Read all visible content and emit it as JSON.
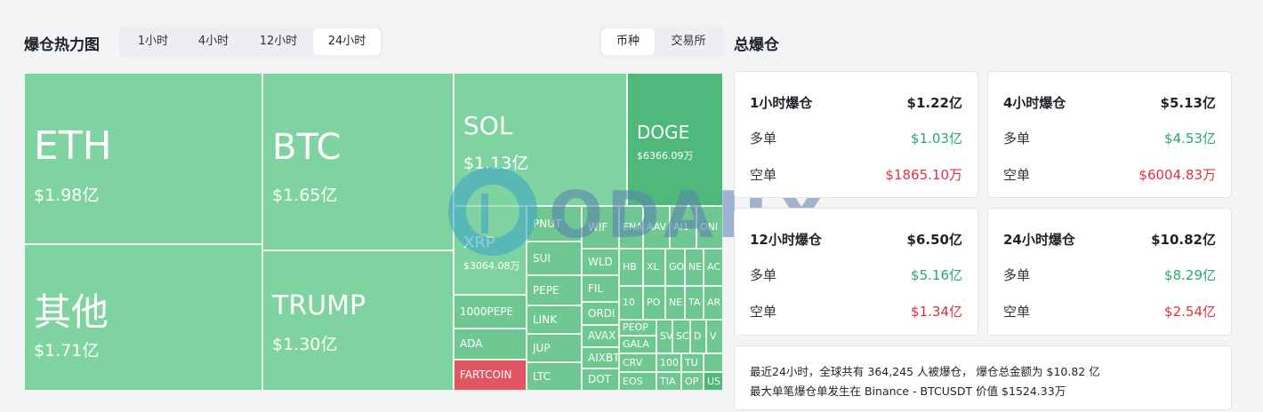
{
  "heatmap": {
    "title": "爆仓热力图",
    "time_tabs": [
      "1小时",
      "4小时",
      "12小时",
      "24小时"
    ],
    "active_time_tab": 3,
    "group_tabs": [
      "币种",
      "交易所"
    ],
    "active_group_tab": 0,
    "tiles": {
      "eth": {
        "symbol": "ETH",
        "value": "$1.98亿"
      },
      "btc": {
        "symbol": "BTC",
        "value": "$1.65亿"
      },
      "other": {
        "symbol": "其他",
        "value": "$1.71亿"
      },
      "trump": {
        "symbol": "TRUMP",
        "value": "$1.30亿"
      },
      "sol": {
        "symbol": "SOL",
        "value": "$1.13亿"
      },
      "doge": {
        "symbol": "DOGE",
        "value": "$6366.09万"
      },
      "xrp": {
        "symbol": "XRP",
        "value": "$3064.08万"
      },
      "small": [
        "PNUT",
        "SUI",
        "PEPE",
        "LINK",
        "JUP",
        "LTC",
        "1000PEPE",
        "ADA",
        "FARTCOIN",
        "WIF",
        "ENA",
        "AAV",
        "AI1",
        "ONI",
        "WLD",
        "FIL",
        "ORDI",
        "AVAX",
        "GALA",
        "AIXBT",
        "CRV",
        "EOS",
        "DOT",
        "HB",
        "XL",
        "GO",
        "NE",
        "AC",
        "10",
        "PO",
        "NE",
        "TA",
        "AR",
        "PEOP",
        "SV",
        "SC",
        "D",
        "V",
        "100",
        "TU",
        "TIA",
        "OP",
        "US"
      ]
    },
    "tile_colors": {
      "base": "#7fd3a0",
      "mid": "#6fc791",
      "deep": "#4fb87b",
      "negative": "#e25563"
    }
  },
  "summary": {
    "title": "总爆仓",
    "cards": [
      {
        "label": "1小时爆仓",
        "total": "$1.22亿",
        "long_label": "多单",
        "long": "$1.03亿",
        "short_label": "空单",
        "short": "$1865.10万"
      },
      {
        "label": "4小时爆仓",
        "total": "$5.13亿",
        "long_label": "多单",
        "long": "$4.53亿",
        "short_label": "空单",
        "short": "$6004.83万"
      },
      {
        "label": "12小时爆仓",
        "total": "$6.50亿",
        "long_label": "多单",
        "long": "$5.16亿",
        "short_label": "空单",
        "short": "$1.34亿"
      },
      {
        "label": "24小时爆仓",
        "total": "$10.82亿",
        "long_label": "多单",
        "long": "$8.29亿",
        "short_label": "空单",
        "short": "$2.54亿"
      }
    ],
    "note_line1": "最近24小时，全球共有 364,245 人被爆仓，  爆仓总金额为 $10.82 亿",
    "note_line2": "最大单笔爆仓单发生在 Binance - BTCUSDT 价值 $1524.33万",
    "long_color": "#27a96a",
    "short_color": "#e0303f"
  },
  "watermark": {
    "text": "ODAILY"
  }
}
